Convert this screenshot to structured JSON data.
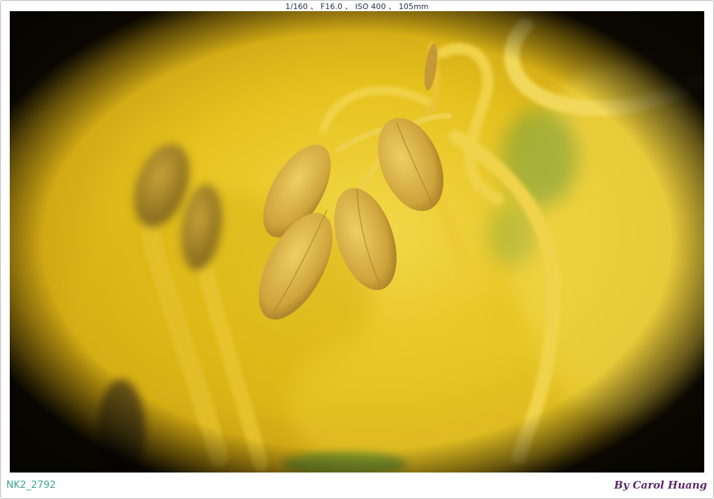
{
  "exif_line": "1/160 、 F16.0 、 ISO 400 、 105mm",
  "file_name": "NK2_2792",
  "signature": "By Carol Huang",
  "colors": {
    "frame_border": "#bdbdbd",
    "petal_yellow": "#e8c51a",
    "anther": "#c9a13a",
    "leaf_green": "#6e9a3a",
    "vignette": "#000000",
    "file_name_text": "#3aa58c",
    "signature_text": "#5a2a6a"
  }
}
